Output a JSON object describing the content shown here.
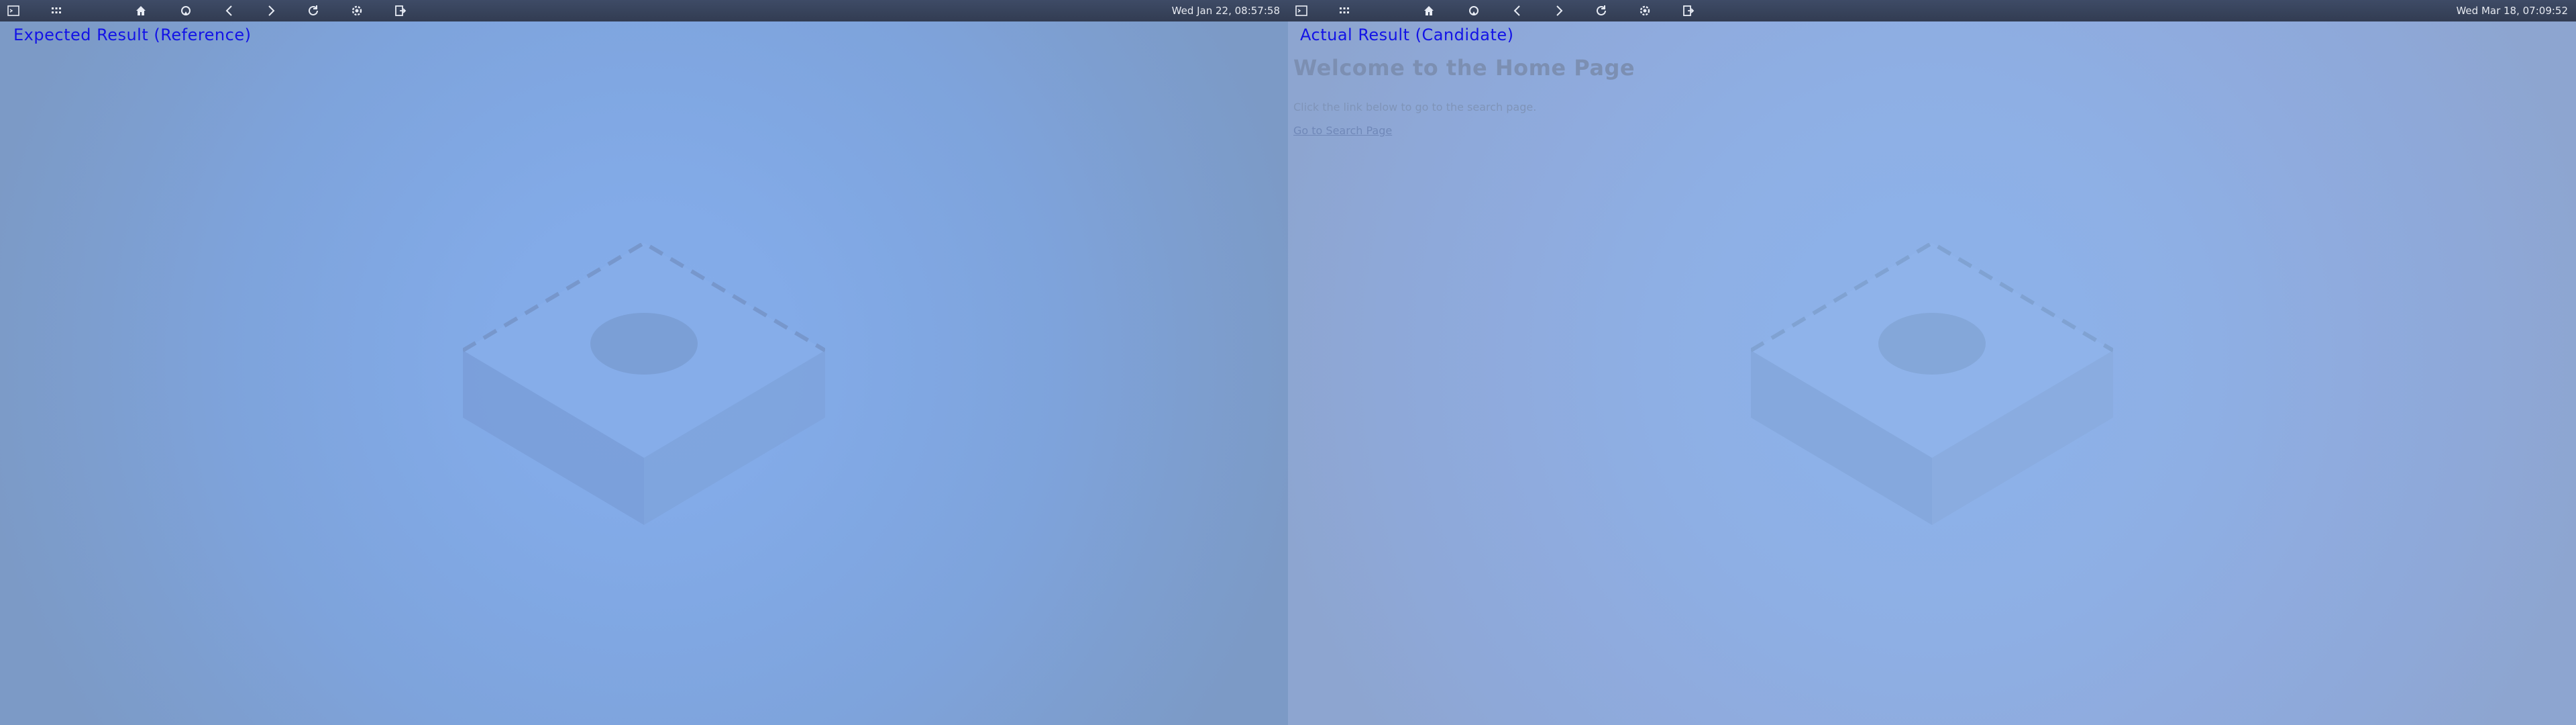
{
  "left": {
    "clock": "Wed Jan 22, 08:57:58",
    "caption": "Expected Result (Reference)"
  },
  "right": {
    "clock": "Wed Mar 18, 07:09:52",
    "caption": "Actual Result (Candidate)",
    "page": {
      "heading": "Welcome to the Home Page",
      "description": "Click the link below to go to the search page.",
      "link": "Go to Search Page"
    }
  },
  "taskbar_icons": [
    "terminal-icon",
    "apps-icon",
    "home-icon",
    "rocket-icon",
    "back-icon",
    "forward-icon",
    "reload-icon",
    "settings-icon",
    "logout-icon"
  ],
  "colors": {
    "caption": "#1313e6",
    "taskbar": "#3a465e"
  }
}
